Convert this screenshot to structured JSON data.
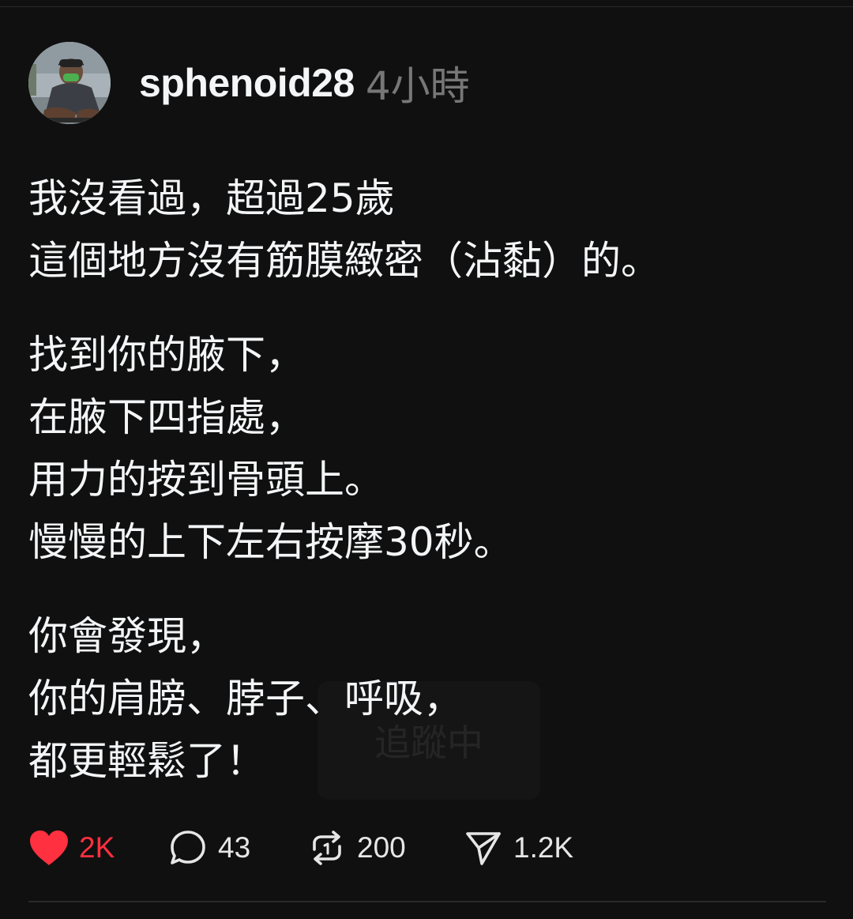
{
  "post": {
    "username": "sphenoid28",
    "time_ago": "4小時",
    "paragraphs": [
      [
        "我沒看過，超過25歲",
        "這個地方沒有筋膜緻密（沾黏）的。"
      ],
      [
        "找到你的腋下，",
        "在腋下四指處，",
        "用力的按到骨頭上。",
        "慢慢的上下左右按摩30秒。"
      ],
      [
        "你會發現，",
        "你的肩膀、脖子、呼吸，",
        "都更輕鬆了！"
      ]
    ],
    "overlay_text": "追蹤中"
  },
  "actions": {
    "likes": "2K",
    "replies": "43",
    "reposts": "200",
    "shares": "1.2K",
    "icons": {
      "like": "heart-icon",
      "reply": "comment-bubble-icon",
      "repost": "repost-icon",
      "share": "send-icon"
    },
    "colors": {
      "liked": "#ff3040",
      "count": "#e6e6e6"
    }
  },
  "theme": {
    "background": "#101010",
    "text": "#f3f5f7",
    "muted": "#777777"
  }
}
